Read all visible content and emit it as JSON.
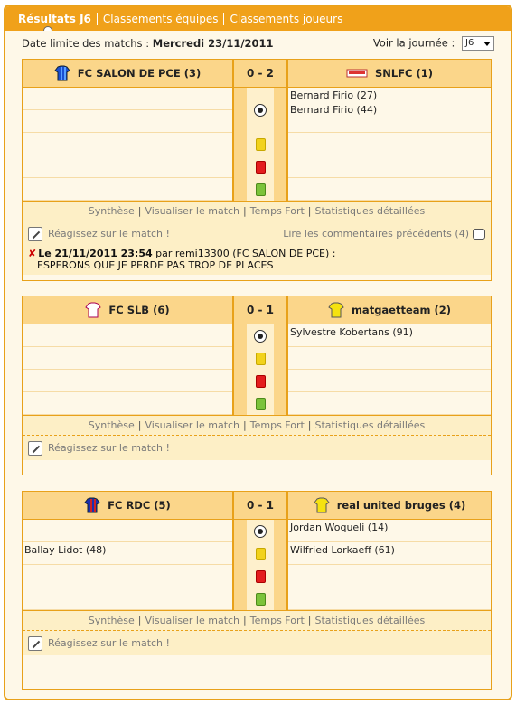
{
  "tabs": [
    {
      "label": "Résultats J6",
      "active": true
    },
    {
      "label": "Classements équipes",
      "active": false
    },
    {
      "label": "Classements joueurs",
      "active": false
    }
  ],
  "header": {
    "deadline_label": "Date limite des matchs :",
    "deadline_value": "Mercredi 23/11/2011",
    "journee_label": "Voir la journée :",
    "journee_value": "J6"
  },
  "links": {
    "synthese": "Synthèse",
    "visualiser": "Visualiser le match",
    "temps_fort": "Temps Fort",
    "stats": "Statistiques détaillées",
    "react": "Réagissez sur le match !"
  },
  "colors": {
    "accent": "#f0a11a",
    "panel": "#fef8e8",
    "header_band": "#fbd68a"
  },
  "matches": [
    {
      "home": "FC SALON DE PCE (3)",
      "away": "SNLFC (1)",
      "score": "0 - 2",
      "home_jersey": "blue-striped-jersey-icon",
      "away_jersey": "snlfc-logo-icon",
      "goals": {
        "home": [
          "",
          ""
        ],
        "away": [
          "Bernard Firio (27)",
          "Bernard Firio (44)"
        ]
      },
      "comments_link": "Lire les commentaires précédents (4)",
      "comment": {
        "prefix": "Le 21/11/2011 23:54",
        "by": "par",
        "author": "remi13300 (FC SALON DE PCE) :",
        "text": "ESPERONS QUE JE PERDE PAS TROP DE PLACES"
      }
    },
    {
      "home": "FC SLB (6)",
      "away": "matgaetteam (2)",
      "score": "0 - 1",
      "home_jersey": "white-jersey-icon",
      "away_jersey": "yellow-jersey-icon",
      "goals": {
        "home": [
          ""
        ],
        "away": [
          "Sylvestre Kobertans (91)"
        ]
      }
    },
    {
      "home": "FC RDC (5)",
      "away": "real united bruges (4)",
      "score": "0 - 1",
      "home_jersey": "blue-striped-jersey-icon",
      "away_jersey": "yellow-jersey-icon",
      "goals": {
        "home": [
          "",
          "Ballay Lidot (48)"
        ],
        "away": [
          "Jordan Woqueli (14)",
          "Wilfried Lorkaeff (61)"
        ]
      }
    }
  ]
}
